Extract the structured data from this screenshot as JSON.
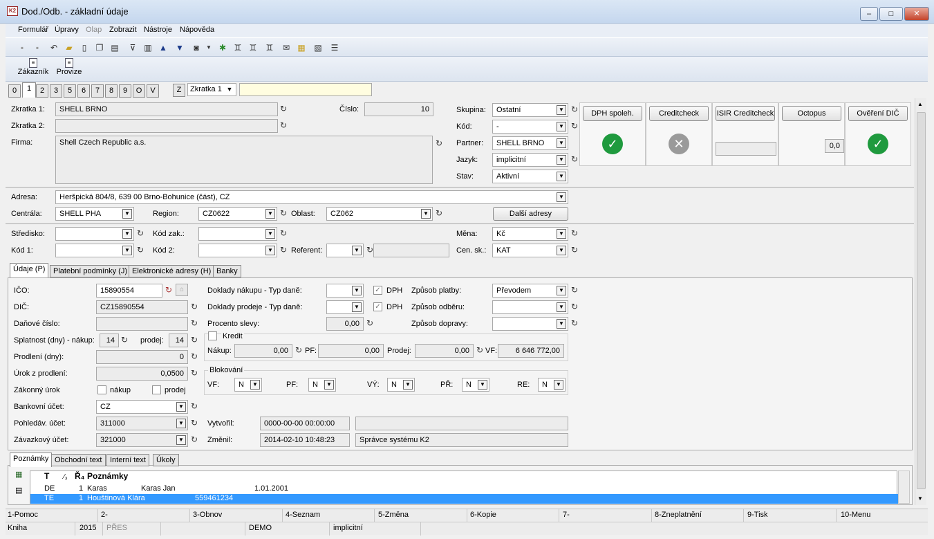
{
  "window": {
    "title": "Dod./Odb. - základní údaje",
    "app_icon": "K2"
  },
  "menu": [
    "Formulář",
    "Úpravy",
    "Olap",
    "Zobrazit",
    "Nástroje",
    "Nápověda"
  ],
  "big_toolbar": {
    "customer": "Zákazník",
    "commission": "Provize"
  },
  "tabs": [
    "0",
    "1",
    "2",
    "3",
    "5",
    "6",
    "7",
    "8",
    "9",
    "O",
    "V"
  ],
  "tab_z": "Z",
  "shortcut_select": "Zkratka 1",
  "top": {
    "zkratka1_label": "Zkratka 1:",
    "zkratka1": "SHELL BRNO",
    "zkratka2_label": "Zkratka 2:",
    "zkratka2": "",
    "firma_label": "Firma:",
    "firma": "Shell Czech Republic a.s.",
    "cislo_label": "Číslo:",
    "cislo": "10",
    "skupina_label": "Skupina:",
    "skupina": "Ostatní",
    "kod_label": "Kód:",
    "kod": "-",
    "partner_label": "Partner:",
    "partner": "SHELL BRNO",
    "jazyk_label": "Jazyk:",
    "jazyk": "implicitní",
    "stav_label": "Stav:",
    "stav": "Aktivní"
  },
  "panels": {
    "dph": "DPH spoleh.",
    "creditcheck": "Creditcheck",
    "isir": "ISIR Creditcheck",
    "octopus": "Octopus",
    "octopus_value": "0,0",
    "dic": "Ověření DIČ"
  },
  "address": {
    "adresa_label": "Adresa:",
    "adresa": "Heršpická 804/8, 639 00  Brno-Bohunice (část), CZ",
    "centrala_label": "Centrála:",
    "centrala": "SHELL PHA",
    "region_label": "Region:",
    "region": "CZ0622",
    "oblast_label": "Oblast:",
    "oblast": "CZ062",
    "dalsi": "Další adresy"
  },
  "misc": {
    "stredisko_label": "Středisko:",
    "kodzak_label": "Kód zak.:",
    "kod1_label": "Kód 1:",
    "kod2_label": "Kód 2:",
    "referent_label": "Referent:",
    "mena_label": "Měna:",
    "mena": "Kč",
    "censk_label": "Cen. sk.:",
    "censk": "KAT"
  },
  "subtabs": [
    "Údaje (P)",
    "Platební podmínky (J)",
    "Elektronické adresy (H)",
    "Banky"
  ],
  "udaje": {
    "ico_label": "IČO:",
    "ico": "15890554",
    "dic_label": "DIČ:",
    "dic": "CZ15890554",
    "danove_label": "Daňové číslo:",
    "danove": "",
    "splatnost_label": "Splatnost (dny) - nákup:",
    "splatnost_nakup": "14",
    "prodej_label": "prodej:",
    "splatnost_prodej": "14",
    "prodleni_label": "Prodlení  (dny):",
    "prodleni": "0",
    "urok_label": "Úrok z prodlení:",
    "urok": "0,0500",
    "zakonny_label": "Zákonný úrok",
    "nakup_chk": "nákup",
    "prodej_chk": "prodej",
    "bankovni_label": "Bankovní účet:",
    "bankovni": "CZ",
    "pohledav_label": "Pohledáv. účet:",
    "pohledav": "311000",
    "zavazkovy_label": "Závazkový účet:",
    "zavazkovy": "321000",
    "doklady_nakup_label": "Doklady nákupu - Typ daně:",
    "doklady_prodej_label": "Doklady prodeje - Typ daně:",
    "dph": "DPH",
    "procento_label": "Procento slevy:",
    "procento": "0,00",
    "zpusob_platby_label": "Způsob platby:",
    "zpusob_platby": "Převodem",
    "zpusob_odberu_label": "Způsob odběru:",
    "zpusob_dopravy_label": "Způsob dopravy:",
    "kredit_label": "Kredit",
    "kr_nakup_label": "Nákup:",
    "kr_nakup": "0,00",
    "kr_pf_label": "PF:",
    "kr_pf": "0,00",
    "kr_prodej_label": "Prodej:",
    "kr_prodej": "0,00",
    "kr_vf_label": "VF:",
    "kr_vf": "6 646 772,00",
    "blokovani_label": "Blokování",
    "bl_vf": "VF:",
    "bl_pf": "PF:",
    "bl_vy": "VÝ:",
    "bl_pr": "PŘ:",
    "bl_re": "RE:",
    "bl_val": "N",
    "vytvoril_label": "Vytvořil:",
    "vytvoril": "0000-00-00 00:00:00",
    "vytvoril_user": "",
    "zmenil_label": "Změnil:",
    "zmenil": "2014-02-10 10:48:23",
    "zmenil_user": "Správce systému K2"
  },
  "notetabs": [
    "Poznámky",
    "Obchodní text",
    "Interní text",
    "Úkoly"
  ],
  "grid": {
    "headers": [
      "T",
      "⁄₃",
      "Ř₄",
      "Poznámky"
    ],
    "rows": [
      {
        "t": "DE",
        "n": "1",
        "a": "Karas",
        "b": "Karas Jan",
        "c": "1.01.2001"
      },
      {
        "t": "TE",
        "n": "1",
        "a": "Houštinová Klára",
        "b": "559461234",
        "c": ""
      }
    ]
  },
  "fkeys": [
    "1-Pomoc",
    "2-",
    "3-Obnov",
    "4-Seznam",
    "5-Změna",
    "6-Kopie",
    "7-",
    "8-Zneplatnění",
    "9-Tisk",
    "10-Menu"
  ],
  "status": [
    "Kniha",
    "2015",
    "PŘES",
    "DEMO",
    "implicitní"
  ]
}
